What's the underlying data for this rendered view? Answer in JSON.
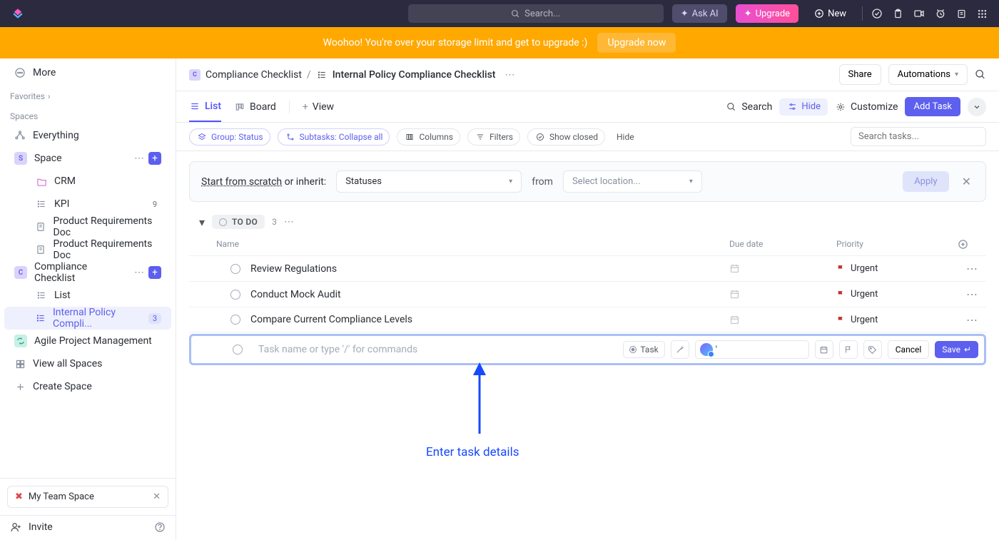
{
  "topbar": {
    "search_placeholder": "Search...",
    "ask_ai": "Ask AI",
    "upgrade": "Upgrade",
    "new": "New"
  },
  "banner": {
    "text": "Woohoo! You're over your storage limit and get to upgrade :)",
    "button": "Upgrade now"
  },
  "sidebar": {
    "more": "More",
    "favorites": "Favorites",
    "spaces": "Spaces",
    "items": [
      {
        "label": "Everything"
      },
      {
        "label": "Space",
        "letter": "S",
        "bg": "#8e7bff"
      },
      {
        "label": "CRM"
      },
      {
        "label": "KPI",
        "badge": "9"
      },
      {
        "label": "Product Requirements Doc"
      },
      {
        "label": "Product Requirements Doc"
      },
      {
        "label": "Compliance Checklist",
        "letter": "C",
        "bg": "#d9d4fb",
        "fg": "#6a5ee6"
      },
      {
        "label": "List"
      },
      {
        "label": "Internal Policy Compli...",
        "badge": "3"
      },
      {
        "label": "Agile Project Management",
        "bg": "#5ad7b3"
      },
      {
        "label": "View all Spaces"
      },
      {
        "label": "Create Space"
      }
    ],
    "team_chip": "My Team Space",
    "invite": "Invite"
  },
  "crumb": {
    "space": "Compliance Checklist",
    "page": "Internal Policy Compliance Checklist",
    "share": "Share",
    "automations": "Automations"
  },
  "tabs": {
    "list": "List",
    "board": "Board",
    "view": "View",
    "search": "Search",
    "hide": "Hide",
    "customize": "Customize",
    "add_task": "Add Task"
  },
  "filters": {
    "group": "Group: Status",
    "subtasks": "Subtasks: Collapse all",
    "columns": "Columns",
    "filters": "Filters",
    "show_closed": "Show closed",
    "hide": "Hide",
    "search_tasks": "Search tasks..."
  },
  "inherit": {
    "scratch": "Start from scratch",
    "or_inherit": " or inherit:",
    "statuses": "Statuses",
    "from": "from",
    "location": "Select location...",
    "apply": "Apply"
  },
  "group": {
    "status": "TO DO",
    "count": "3"
  },
  "columns": {
    "name": "Name",
    "due": "Due date",
    "priority": "Priority"
  },
  "tasks": [
    {
      "name": "Review Regulations",
      "priority": "Urgent"
    },
    {
      "name": "Conduct Mock Audit",
      "priority": "Urgent"
    },
    {
      "name": "Compare Current Compliance Levels",
      "priority": "Urgent"
    }
  ],
  "new_task": {
    "placeholder": "Task name or type '/' for commands",
    "task_btn": "Task",
    "assignee_value": "'",
    "cancel": "Cancel",
    "save": "Save"
  },
  "annotation": "Enter task details"
}
